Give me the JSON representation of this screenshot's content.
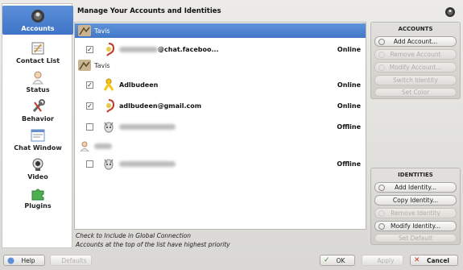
{
  "sidebar": {
    "items": [
      {
        "label": "Accounts",
        "icon": "accounts-icon",
        "active": true
      },
      {
        "label": "Contact List",
        "icon": "contact-list-icon"
      },
      {
        "label": "Status",
        "icon": "status-icon"
      },
      {
        "label": "Behavior",
        "icon": "behavior-icon"
      },
      {
        "label": "Chat Window",
        "icon": "chat-window-icon"
      },
      {
        "label": "Video",
        "icon": "video-icon"
      },
      {
        "label": "Plugins",
        "icon": "plugins-icon"
      }
    ]
  },
  "header": {
    "title": "Manage Your Accounts and Identities"
  },
  "accounts": {
    "groups": [
      {
        "name": "Tavis",
        "selected": true
      },
      {
        "name": "Tavis",
        "selected": false
      },
      {
        "name": "",
        "selected": false
      }
    ],
    "rows": [
      {
        "name_suffix": "@chat.faceboo...",
        "status": "Online",
        "checked": true,
        "protocol": "jabber-icon"
      },
      {
        "name": "Adlbudeen",
        "status": "Online",
        "checked": true,
        "protocol": "aim-icon"
      },
      {
        "name": "adlbudeen@gmail.com",
        "status": "Online",
        "checked": true,
        "protocol": "jabber-icon"
      },
      {
        "name": "",
        "status": "Offline",
        "checked": false,
        "protocol": "yahoo-icon"
      },
      {
        "name": "",
        "status": "Offline",
        "checked": false,
        "protocol": "yahoo-icon"
      }
    ]
  },
  "hints": {
    "line1": "Check to Include in Global Connection",
    "line2": "Accounts at the top of the list have highest priority"
  },
  "accounts_panel": {
    "title": "ACCOUNTS",
    "buttons": [
      "Add Account...",
      "Remove Account",
      "Modify Account...",
      "Switch Identity",
      "Set Color"
    ]
  },
  "identities_panel": {
    "title": "IDENTITIES",
    "buttons": [
      "Add Identity...",
      "Copy Identity...",
      "Remove Identity",
      "Modify Identity...",
      "Set Default"
    ]
  },
  "footer": {
    "help": "Help",
    "defaults": "Defaults",
    "ok": "OK",
    "apply": "Apply",
    "cancel": "Cancel"
  },
  "colors": {
    "accent": "#4a7fcf",
    "select": "#4277c6"
  }
}
